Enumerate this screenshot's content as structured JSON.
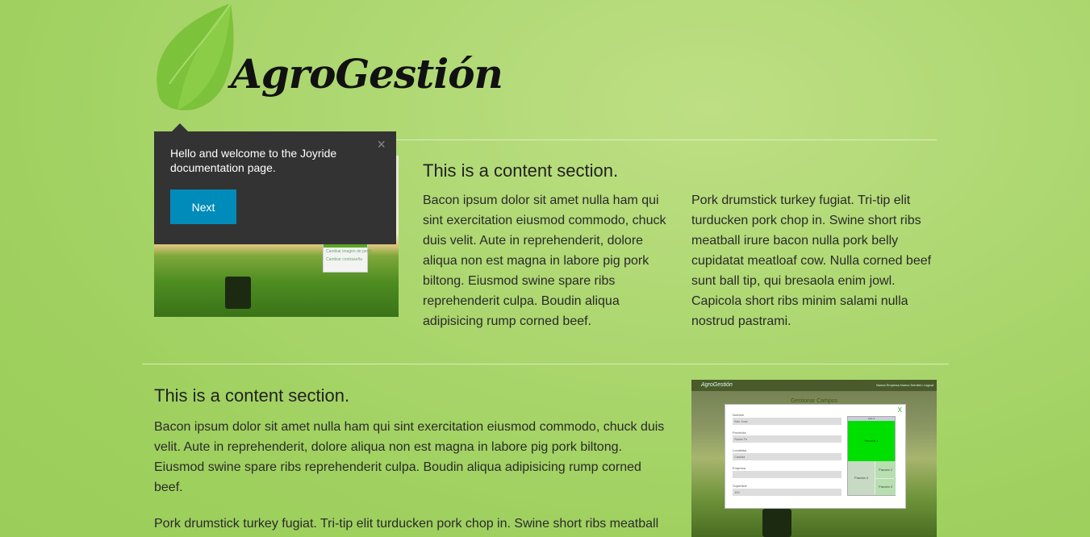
{
  "logo": {
    "text": "AgroGestión",
    "leaf_color": "#7cc23a",
    "leaf_color_light": "#a8d96b"
  },
  "joyride": {
    "text": "Hello and welcome to the Joyride documentation page.",
    "close_icon": "×",
    "next_label": "Next",
    "background": "#333333",
    "button_color": "#008cba"
  },
  "section1": {
    "title": "This is a content section.",
    "col1": "Bacon ipsum dolor sit amet nulla ham qui sint exercitation eiusmod commodo, chuck duis velit. Aute in reprehenderit, dolore aliqua non est magna in labore pig pork biltong. Eiusmod swine spare ribs reprehenderit culpa. Boudin aliqua adipisicing rump corned beef.",
    "col2": "Pork drumstick turkey fugiat. Tri-tip elit turducken pork chop in. Swine short ribs meatball irure bacon nulla pork belly cupidatat meatloaf cow. Nulla corned beef sunt ball tip, qui bresaola enim jowl. Capicola short ribs minim salami nulla nostrud pastrami."
  },
  "section2": {
    "title": "This is a content section.",
    "p1": "Bacon ipsum dolor sit amet nulla ham qui sint exercitation eiusmod commodo, chuck duis velit. Aute in reprehenderit, dolore aliqua non est magna in labore pig pork biltong. Eiusmod swine spare ribs reprehenderit culpa. Boudin aliqua adipisicing rump corned beef.",
    "p2": "Pork drumstick turkey fugiat. Tri-tip elit turducken pork chop in. Swine short ribs meatball"
  },
  "thumb1": {
    "card_line1": "Cambiar imagen de perfil",
    "card_line2": "Cambiar contraseña"
  },
  "thumb2": {
    "brand": "AgroGestión",
    "nav": "Nueva Empresa   Nuevo Sembrío   Logout",
    "heading": "Gestionar Campos",
    "close": "X",
    "fields": [
      {
        "label": "Nombre",
        "value": "San Jose"
      },
      {
        "label": "Provincia",
        "value": "Santa Fe"
      },
      {
        "label": "Localidad",
        "value": "Casilda"
      },
      {
        "label": "Empresa",
        "value": ""
      },
      {
        "label": "Superficie",
        "value": "100"
      }
    ],
    "plots_header": "Lote 3",
    "plot_big": "Parcela 1",
    "plot_4": "Parcela 4",
    "plot_2": "Parcela 2",
    "plot_3": "Parcela 3"
  }
}
